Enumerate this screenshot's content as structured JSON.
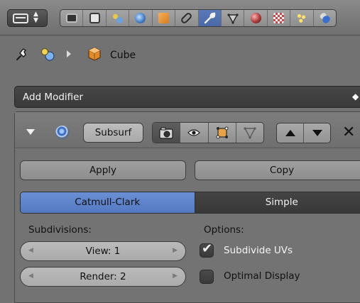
{
  "header": {
    "editor_type_icon": "properties-editor-icon",
    "tabs": [
      {
        "name": "render-tab",
        "icon": "camera-icon",
        "color": "#3b3b3b"
      },
      {
        "name": "render-layers-tab",
        "icon": "render-layers-icon",
        "color": "#555555"
      },
      {
        "name": "scene-tab",
        "icon": "scene-icon",
        "color": "#6aa0dc"
      },
      {
        "name": "world-tab",
        "icon": "world-icon",
        "color": "#3f78c4"
      },
      {
        "name": "object-tab",
        "icon": "cube-icon",
        "color": "#e08a2e"
      },
      {
        "name": "constraints-tab",
        "icon": "constraint-chain-icon",
        "color": "#3a3a3a"
      },
      {
        "name": "modifiers-tab",
        "icon": "wrench-icon",
        "color": "#1e1e1e",
        "active": true
      },
      {
        "name": "data-tab",
        "icon": "mesh-data-icon",
        "color": "#3a3a3a"
      },
      {
        "name": "material-tab",
        "icon": "material-sphere-icon",
        "color": "#aa3a3a"
      },
      {
        "name": "texture-tab",
        "icon": "texture-checker-icon",
        "color": "#b84b4b"
      },
      {
        "name": "particles-tab",
        "icon": "particles-icon",
        "color": "#e2c23a"
      },
      {
        "name": "physics-tab",
        "icon": "physics-icon",
        "color": "#3b6fcf"
      }
    ]
  },
  "breadcrumb": {
    "object_name": "Cube",
    "pin_icon": "pin-icon",
    "scene_icon": "scene-object-icon",
    "object_icon": "cube-icon"
  },
  "add_modifier": {
    "label": "Add Modifier"
  },
  "modifier": {
    "name": "Subsurf",
    "apply_label": "Apply",
    "copy_label": "Copy",
    "algorithm_options": [
      "Catmull-Clark",
      "Simple"
    ],
    "selected_algorithm": "Catmull-Clark",
    "subdivisions_label": "Subdivisions:",
    "options_label": "Options:",
    "view_value": "View: 1",
    "render_value": "Render: 2",
    "subdivide_uvs_label": "Subdivide UVs",
    "subdivide_uvs_checked": true,
    "optimal_display_label": "Optimal Display",
    "optimal_display_checked": false,
    "accent_color": "#5a82cc"
  }
}
